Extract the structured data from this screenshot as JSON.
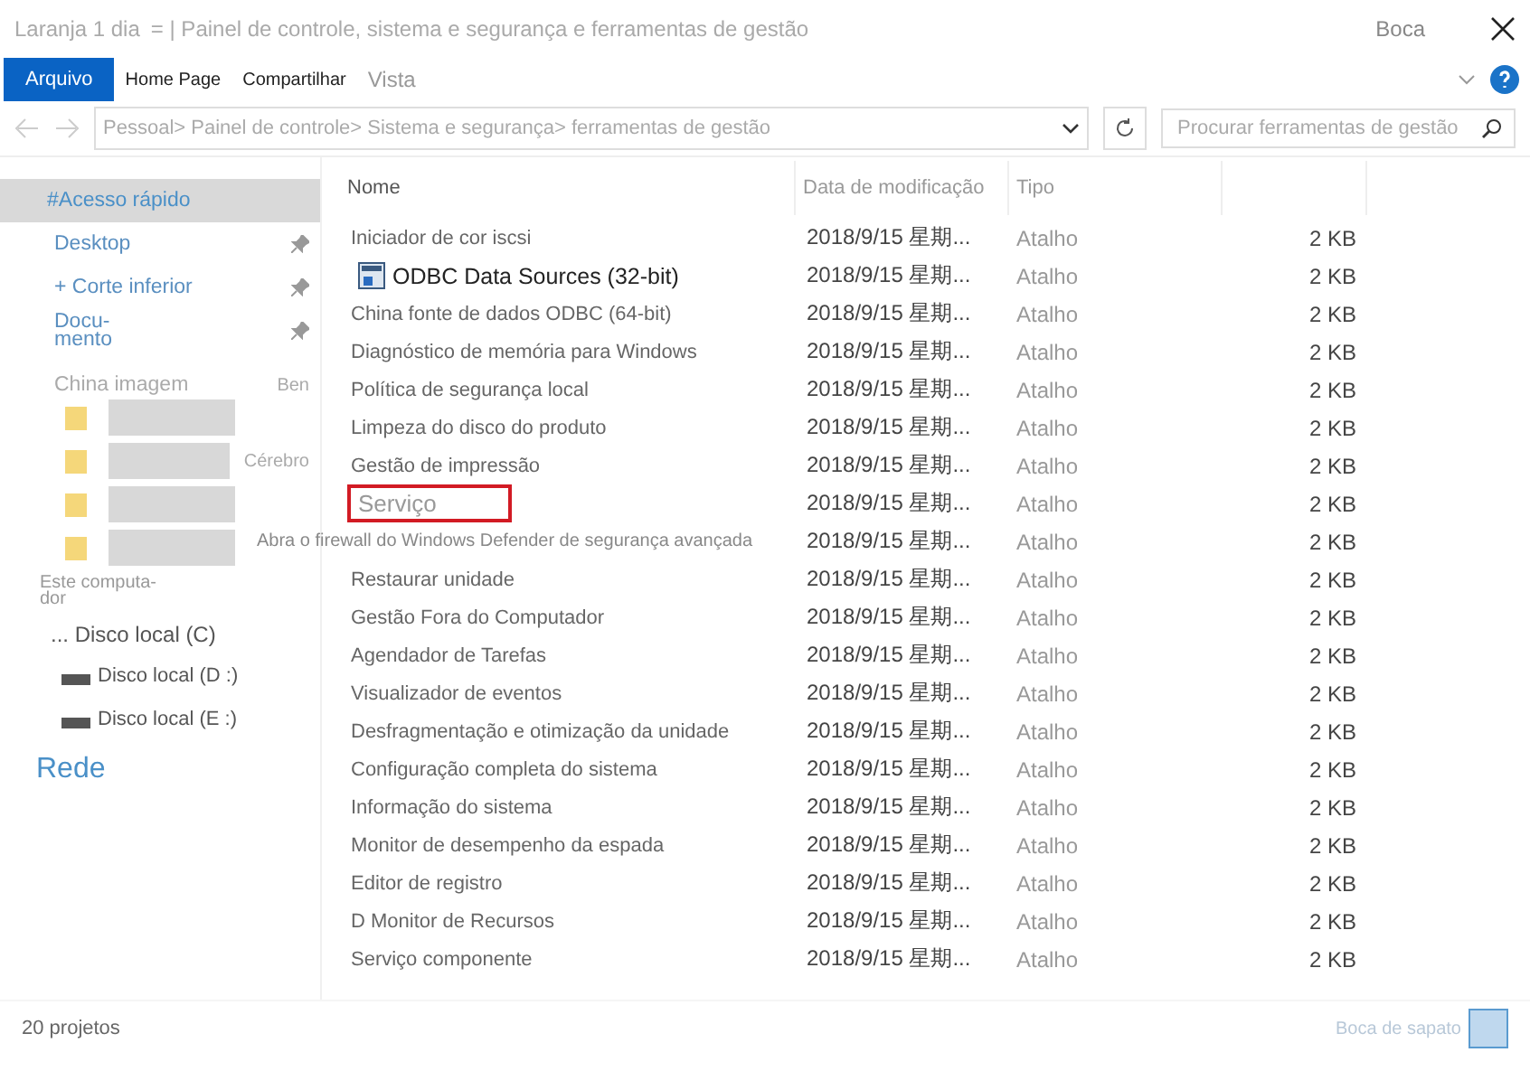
{
  "window": {
    "title_prefix": "Laranja 1 dia",
    "title": "= | Painel de controle, sistema e segurança e ferramentas de gestão",
    "right_label": "Boca"
  },
  "ribbon": {
    "tabs": [
      {
        "label": "Arquivo",
        "selected": true
      },
      {
        "label": "Home Page",
        "selected": false
      },
      {
        "label": "Compartilhar",
        "selected": false
      },
      {
        "label": "Vista",
        "selected": false
      }
    ]
  },
  "address": {
    "path": "Pessoal> Painel de controle> Sistema e segurança> ferramentas de gestão"
  },
  "search": {
    "placeholder": "Procurar ferramentas de gestão"
  },
  "sidebar": {
    "items": [
      {
        "kind": "header",
        "label": "#Acesso rápido",
        "selected": true
      },
      {
        "kind": "pinned",
        "label": "Desktop",
        "selected": false
      },
      {
        "kind": "pinned",
        "label": "+ Corte inferior",
        "selected": false
      },
      {
        "kind": "pinned",
        "label": "Docu-\nmento",
        "selected": false
      },
      {
        "kind": "side",
        "label": "China imagem",
        "note": "Ben",
        "selected": false
      },
      {
        "kind": "folder",
        "selected": false
      },
      {
        "kind": "folder",
        "note": "Cérebro",
        "selected": false
      },
      {
        "kind": "folder",
        "selected": false
      },
      {
        "kind": "folder",
        "selected": false
      },
      {
        "kind": "computer",
        "label": "Este computa-\ndor",
        "selected": false
      },
      {
        "kind": "drive",
        "label": "... Disco local (C)",
        "selected": false
      },
      {
        "kind": "drive_icon",
        "label": "Disco local (D :)",
        "selected": false
      },
      {
        "kind": "drive_icon",
        "label": "Disco local (E :)",
        "selected": false
      },
      {
        "kind": "network",
        "label": "Rede",
        "selected": false
      }
    ]
  },
  "table": {
    "columns": [
      "Nome",
      "Data de modificação",
      "Tipo"
    ],
    "rows": [
      {
        "name": "Iniciador de cor iscsi",
        "date": "2018/9/15 星期...",
        "type": "Atalho",
        "size": "2 KB",
        "highlighted": false,
        "kind": "plain"
      },
      {
        "name": "ODBC Data Sources (32-bit)",
        "date": "2018/9/15 星期...",
        "type": "Atalho",
        "size": "2 KB",
        "highlighted": false,
        "kind": "icon"
      },
      {
        "name": "China fonte de dados ODBC (64-bit)",
        "date": "2018/9/15 星期...",
        "type": "Atalho",
        "size": "2 KB",
        "highlighted": false,
        "kind": "plain"
      },
      {
        "name": "Diagnóstico de memória para Windows",
        "date": "2018/9/15 星期...",
        "type": "Atalho",
        "size": "2 KB",
        "highlighted": false,
        "kind": "plain"
      },
      {
        "name": "Política de segurança local",
        "date": "2018/9/15 星期...",
        "type": "Atalho",
        "size": "2 KB",
        "highlighted": false,
        "kind": "plain"
      },
      {
        "name": "Limpeza do disco do produto",
        "date": "2018/9/15 星期...",
        "type": "Atalho",
        "size": "2 KB",
        "highlighted": false,
        "kind": "plain"
      },
      {
        "name": "Gestão de impressão",
        "date": "2018/9/15 星期...",
        "type": "Atalho",
        "size": "2 KB",
        "highlighted": false,
        "kind": "plain"
      },
      {
        "name": "Serviço",
        "date": "2018/9/15 星期...",
        "type": "Atalho",
        "size": "2 KB",
        "highlighted": true,
        "kind": "plain"
      },
      {
        "name": "Abra o firewall do Windows Defender de segurança avançada",
        "date": "2018/9/15 星期...",
        "type": "Atalho",
        "size": "2 KB",
        "highlighted": false,
        "kind": "wide"
      },
      {
        "name": "Restaurar unidade",
        "date": "2018/9/15 星期...",
        "type": "Atalho",
        "size": "2 KB",
        "highlighted": false,
        "kind": "plain"
      },
      {
        "name": "Gestão Fora do Computador",
        "date": "2018/9/15 星期...",
        "type": "Atalho",
        "size": "2 KB",
        "highlighted": false,
        "kind": "plain"
      },
      {
        "name": "Agendador de Tarefas",
        "date": "2018/9/15 星期...",
        "type": "Atalho",
        "size": "2 KB",
        "highlighted": false,
        "kind": "plain"
      },
      {
        "name": "Visualizador de eventos",
        "date": "2018/9/15 星期...",
        "type": "Atalho",
        "size": "2 KB",
        "highlighted": false,
        "kind": "plain"
      },
      {
        "name": "Desfragmentação e otimização da unidade",
        "date": "2018/9/15 星期...",
        "type": "Atalho",
        "size": "2 KB",
        "highlighted": false,
        "kind": "plain"
      },
      {
        "name": "Configuração completa do sistema",
        "date": "2018/9/15 星期...",
        "type": "Atalho",
        "size": "2 KB",
        "highlighted": false,
        "kind": "plain"
      },
      {
        "name": "Informação do sistema",
        "date": "2018/9/15 星期...",
        "type": "Atalho",
        "size": "2 KB",
        "highlighted": false,
        "kind": "plain"
      },
      {
        "name": "Monitor de desempenho da espada",
        "date": "2018/9/15 星期...",
        "type": "Atalho",
        "size": "2 KB",
        "highlighted": false,
        "kind": "plain"
      },
      {
        "name": "Editor de registro",
        "date": "2018/9/15 星期...",
        "type": "Atalho",
        "size": "2 KB",
        "highlighted": false,
        "kind": "plain"
      },
      {
        "name": "D Monitor de Recursos",
        "date": "2018/9/15 星期...",
        "type": "Atalho",
        "size": "2 KB",
        "highlighted": false,
        "kind": "plain"
      },
      {
        "name": "Serviço componente",
        "date": "2018/9/15 星期...",
        "type": "Atalho",
        "size": "2 KB",
        "highlighted": false,
        "kind": "plain"
      }
    ]
  },
  "status_bar": {
    "count": "20 projetos",
    "right": "Boca de sapato"
  }
}
